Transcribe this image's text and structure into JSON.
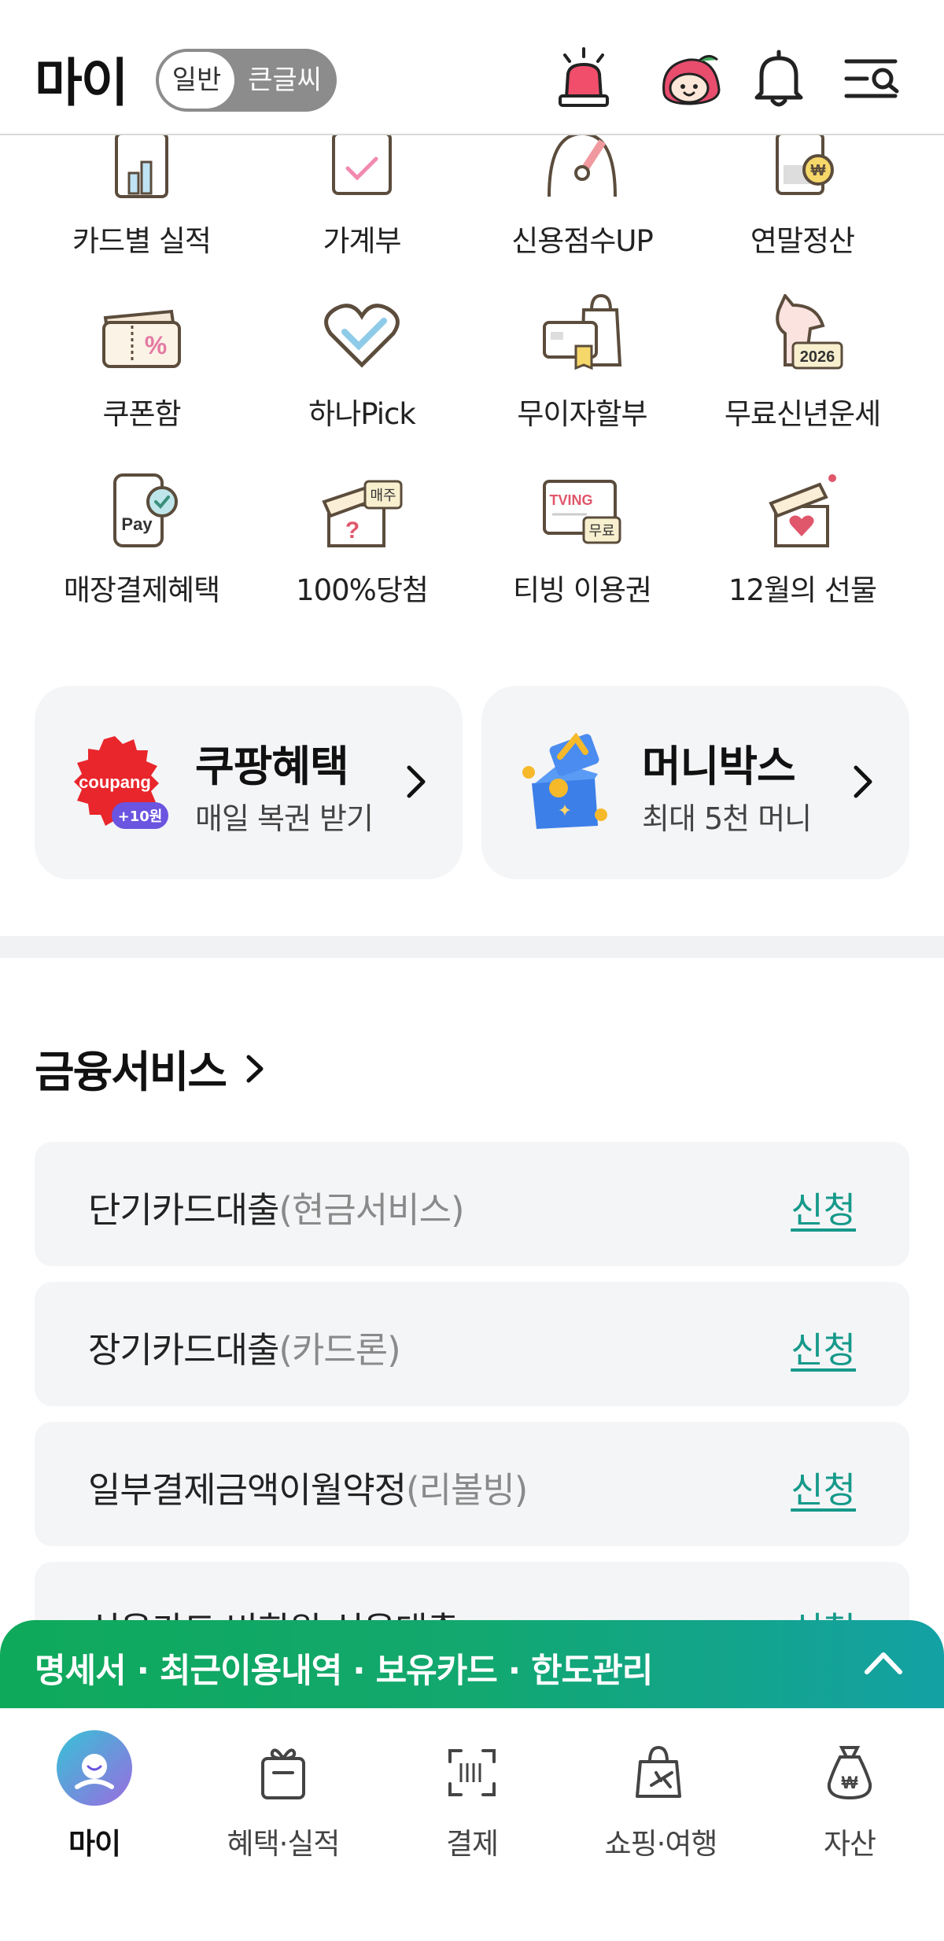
{
  "header": {
    "title": "마이",
    "mode_normal": "일반",
    "mode_large": "큰글씨",
    "icons": [
      "alert-siren-icon",
      "character-avatar-icon",
      "bell-icon",
      "menu-search-icon"
    ]
  },
  "menu": {
    "items": [
      {
        "label": "카드별 실적",
        "icon": "bar-chart-card-icon"
      },
      {
        "label": "가계부",
        "icon": "calendar-check-icon"
      },
      {
        "label": "신용점수UP",
        "icon": "gauge-icon"
      },
      {
        "label": "연말정산",
        "icon": "document-won-icon"
      },
      {
        "label": "쿠폰함",
        "icon": "coupon-icon"
      },
      {
        "label": "하나Pick",
        "icon": "heart-pick-icon"
      },
      {
        "label": "무이자할부",
        "icon": "shopping-bag-card-icon"
      },
      {
        "label": "무료신년운세",
        "icon": "horse-2026-icon"
      },
      {
        "label": "매장결제혜택",
        "icon": "pay-phone-icon"
      },
      {
        "label": "100%당첨",
        "icon": "gift-question-icon"
      },
      {
        "label": "티빙 이용권",
        "icon": "tving-monitor-icon"
      },
      {
        "label": "12월의 선물",
        "icon": "gift-heart-icon"
      }
    ],
    "badge_2026": "2026",
    "badge_weekly": "매주",
    "badge_free": "무료",
    "tving_text": "TVING",
    "pay_text": "Pay"
  },
  "promos": [
    {
      "title": "쿠팡혜택",
      "subtitle": "매일 복권 받기",
      "logo_text": "coupang",
      "badge": "+10원"
    },
    {
      "title": "머니박스",
      "subtitle": "최대 5천 머니"
    }
  ],
  "finance": {
    "section_title": "금융서비스",
    "items": [
      {
        "name": "단기카드대출",
        "sub": "(현금서비스)",
        "action": "신청"
      },
      {
        "name": "장기카드대출",
        "sub": "(카드론)",
        "action": "신청"
      },
      {
        "name": "일부결제금액이월약정",
        "sub": "(리볼빙)",
        "action": "신청"
      },
      {
        "name": "신용카드 비회원 신용대출",
        "sub": "",
        "action": "신청"
      }
    ]
  },
  "quickbar": {
    "text": "명세서 · 최근이용내역 · 보유카드 · 한도관리"
  },
  "bottom_nav": {
    "items": [
      {
        "label": "마이",
        "icon": "my-avatar-icon"
      },
      {
        "label": "혜택·실적",
        "icon": "gift-box-icon"
      },
      {
        "label": "결제",
        "icon": "barcode-scan-icon"
      },
      {
        "label": "쇼핑·여행",
        "icon": "shopping-travel-icon"
      },
      {
        "label": "자산",
        "icon": "money-bag-icon"
      }
    ]
  },
  "colors": {
    "accent": "#15998a",
    "quickbar_start": "#0fa95b",
    "quickbar_end": "#14a1a4",
    "card_bg": "#f4f5f7"
  }
}
